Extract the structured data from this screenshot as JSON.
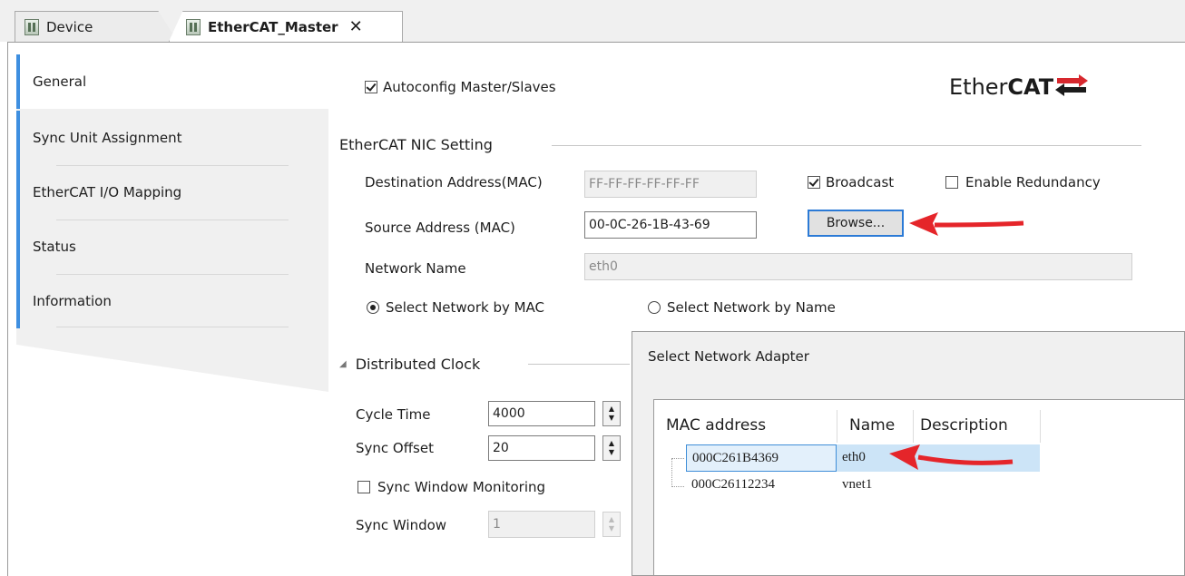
{
  "tabs": [
    {
      "label": "Device"
    },
    {
      "label": "EtherCAT_Master",
      "close": "✕"
    }
  ],
  "nav": {
    "items": [
      {
        "label": "General"
      },
      {
        "label": "Sync Unit Assignment"
      },
      {
        "label": "EtherCAT I/O Mapping"
      },
      {
        "label": "Status"
      },
      {
        "label": "Information"
      }
    ]
  },
  "general": {
    "autoconfig_label": "Autoconfig Master/Slaves",
    "logo": {
      "prefix": "Ether",
      "suffix": "CAT"
    },
    "nic_section_title": "EtherCAT NIC Setting",
    "dest_label": "Destination Address(MAC)",
    "dest_value": "FF-FF-FF-FF-FF-FF",
    "broadcast_label": "Broadcast",
    "redundancy_label": "Enable Redundancy",
    "source_label": "Source Address (MAC)",
    "source_value": "00-0C-26-1B-43-69",
    "browse_label": "Browse...",
    "network_name_label": "Network Name",
    "network_name_value": "eth0",
    "select_by_mac_label": "Select Network by MAC",
    "select_by_name_label": "Select Network by Name",
    "dc_section_title": "Distributed Clock",
    "cycle_time_label": "Cycle Time",
    "cycle_time_value": "4000",
    "sync_offset_label": "Sync Offset",
    "sync_offset_value": "20",
    "sync_window_monitoring_label": "Sync Window Monitoring",
    "sync_window_label": "Sync Window",
    "sync_window_value": "1"
  },
  "dialog": {
    "title": "Select Network Adapter",
    "columns": [
      "MAC address",
      "Name",
      "Description"
    ],
    "rows": [
      {
        "mac": "000C261B4369",
        "name": "eth0",
        "description": ""
      },
      {
        "mac": "000C26112234",
        "name": "vnet1",
        "description": ""
      }
    ]
  },
  "colors": {
    "accent": "#3e8fe0",
    "arrow": "#e5252a",
    "selection": "#cce4f7"
  }
}
